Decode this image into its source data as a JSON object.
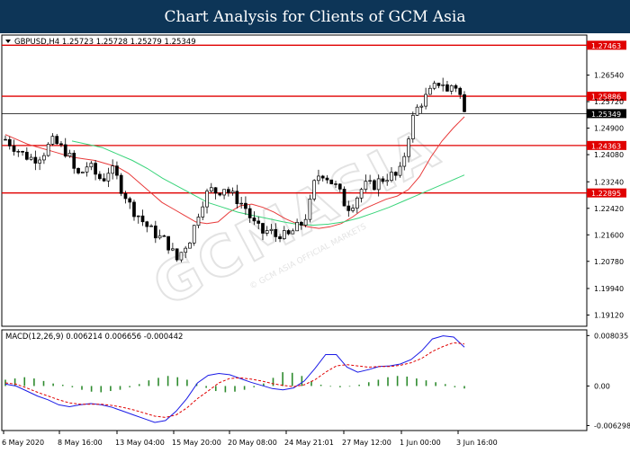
{
  "banner": {
    "title": "Chart Analysis for Clients of GCM Asia"
  },
  "watermark": {
    "brand": "GCMASIA",
    "sub": "© GCM ASIA OFFICIAL MARKETS"
  },
  "colors": {
    "banner_bg": "#0d3557",
    "level_line": "#e00000",
    "candle": "#000000",
    "ma_fast": "#e83a3a",
    "ma_slow": "#39d47a",
    "macd_hist": "#2e8b2e",
    "macd_line": "#1a1ae6",
    "signal_line": "#e00000",
    "price_tag_bg": "#e00000",
    "current_tag_bg": "#000000"
  },
  "chart_data": [
    {
      "type": "candlestick",
      "header": "GBPUSD,H4  1.25723 1.25728 1.25279 1.25349",
      "symbol": "GBPUSD",
      "timeframe": "H4",
      "ohlc": {
        "open": 1.25723,
        "high": 1.25728,
        "low": 1.25279,
        "close": 1.25349
      },
      "ylim": [
        1.188,
        1.2775
      ],
      "y_ticks": [
        "1.26540",
        "1.25720",
        "1.24900",
        "1.24080",
        "1.23240",
        "1.22420",
        "1.21600",
        "1.20780",
        "1.19940",
        "1.19120"
      ],
      "x_ticks": [
        "6 May 2020",
        "8 May 16:00",
        "13 May 04:00",
        "15 May 20:00",
        "20 May 08:00",
        "24 May 21:01",
        "27 May 12:00",
        "1 Jun 00:00",
        "3 Jun 16:00"
      ],
      "levels": [
        "1.27463",
        "1.25886",
        "1.24363",
        "1.22895"
      ],
      "current_price": "1.25349",
      "close_path": [
        1.2455,
        1.244,
        1.2425,
        1.241,
        1.24,
        1.2395,
        1.2405,
        1.242,
        1.245,
        1.244,
        1.2425,
        1.241,
        1.236,
        1.234,
        1.2375,
        1.2365,
        1.234,
        1.233,
        1.236,
        1.2355,
        1.231,
        1.228,
        1.224,
        1.2225,
        1.22,
        1.218,
        1.2165,
        1.215,
        1.214,
        1.211,
        1.208,
        1.212,
        1.214,
        1.219,
        1.225,
        1.2285,
        1.23,
        1.229,
        1.231,
        1.229,
        1.2275,
        1.226,
        1.224,
        1.22,
        1.218,
        1.2165,
        1.2175,
        1.2155,
        1.2165,
        1.215,
        1.217,
        1.2185,
        1.22,
        1.225,
        1.233,
        1.2355,
        1.234,
        1.232,
        1.23,
        1.226,
        1.2245,
        1.227,
        1.23,
        1.2315,
        1.231,
        1.2325,
        1.2335,
        1.2345,
        1.234,
        1.236,
        1.245,
        1.252,
        1.256,
        1.258,
        1.26,
        1.262,
        1.264,
        1.26,
        1.263,
        1.261,
        1.2535
      ],
      "ma_fast_path": [
        1.247,
        1.2455,
        1.244,
        1.243,
        1.242,
        1.241,
        1.24,
        1.2395,
        1.239,
        1.238,
        1.237,
        1.235,
        1.232,
        1.229,
        1.226,
        1.224,
        1.222,
        1.22,
        1.2195,
        1.22,
        1.223,
        1.225,
        1.2255,
        1.2245,
        1.223,
        1.221,
        1.2195,
        1.2185,
        1.218,
        1.2185,
        1.2195,
        1.2215,
        1.224,
        1.2255,
        1.227,
        1.228,
        1.23,
        1.234,
        1.24,
        1.245,
        1.249,
        1.2525
      ],
      "ma_slow_path": [
        1.245,
        1.244,
        1.243,
        1.241,
        1.239,
        1.2365,
        1.2335,
        1.231,
        1.2285,
        1.226,
        1.2245,
        1.223,
        1.222,
        1.221,
        1.22,
        1.2192,
        1.219,
        1.2193,
        1.22,
        1.2212,
        1.2228,
        1.2245,
        1.2265,
        1.2285,
        1.2305,
        1.2325,
        1.2345
      ],
      "watermark_text": "GCMASIA"
    },
    {
      "type": "macd",
      "header": "MACD(12,26,9) 0.006214 0.006656 -0.000442",
      "params": "12,26,9",
      "macd": 0.006214,
      "signal": 0.006656,
      "histogram": -0.000442,
      "ylim": [
        -0.00695,
        0.0088
      ],
      "y_ticks": [
        "0.008035",
        "0.00",
        "-0.006298"
      ],
      "macd_path": [
        0.0003,
        0.0,
        -0.0008,
        -0.0016,
        -0.0022,
        -0.003,
        -0.0033,
        -0.003,
        -0.0028,
        -0.003,
        -0.0034,
        -0.004,
        -0.0046,
        -0.0052,
        -0.0058,
        -0.0055,
        -0.004,
        -0.002,
        0.0005,
        0.0017,
        0.002,
        0.0018,
        0.0012,
        0.0006,
        0.0001,
        -0.0004,
        -0.0006,
        -0.0003,
        0.0008,
        0.0028,
        0.005,
        0.005,
        0.003,
        0.0022,
        0.0026,
        0.0031,
        0.0032,
        0.0035,
        0.0042,
        0.0056,
        0.0075,
        0.008,
        0.0078,
        0.0062
      ],
      "signal_path": [
        0.0005,
        0.0003,
        -0.0003,
        -0.001,
        -0.0016,
        -0.0022,
        -0.0027,
        -0.0029,
        -0.0029,
        -0.0029,
        -0.0031,
        -0.0034,
        -0.0038,
        -0.0043,
        -0.0048,
        -0.005,
        -0.0046,
        -0.0035,
        -0.002,
        -0.0008,
        0.0005,
        0.0012,
        0.0013,
        0.0011,
        0.0008,
        0.0004,
        0.0001,
        -0.0001,
        0.0002,
        0.001,
        0.0022,
        0.0032,
        0.0034,
        0.0032,
        0.003,
        0.0031,
        0.0031,
        0.0033,
        0.0037,
        0.0044,
        0.0055,
        0.0063,
        0.0069,
        0.0067
      ],
      "histogram_path": [
        0.001,
        0.0012,
        0.0014,
        0.0012,
        0.0008,
        0.0004,
        0.0002,
        -0.0002,
        -0.0006,
        -0.0009,
        -0.001,
        -0.0008,
        -0.0006,
        -0.0002,
        0.0003,
        0.0009,
        0.0013,
        0.0016,
        0.0014,
        0.001,
        0.0004,
        -0.0003,
        -0.0008,
        -0.001,
        -0.0009,
        -0.0006,
        -0.0002,
        0.0004,
        0.0013,
        0.0022,
        0.0021,
        0.0016,
        0.0008,
        0.0002,
        -0.0001,
        -0.0002,
        -0.0001,
        0.0002,
        0.0006,
        0.001,
        0.0014,
        0.0016,
        0.0015,
        0.0012,
        0.0009,
        0.0006,
        0.0003,
        -0.0002,
        -0.0004
      ]
    }
  ]
}
